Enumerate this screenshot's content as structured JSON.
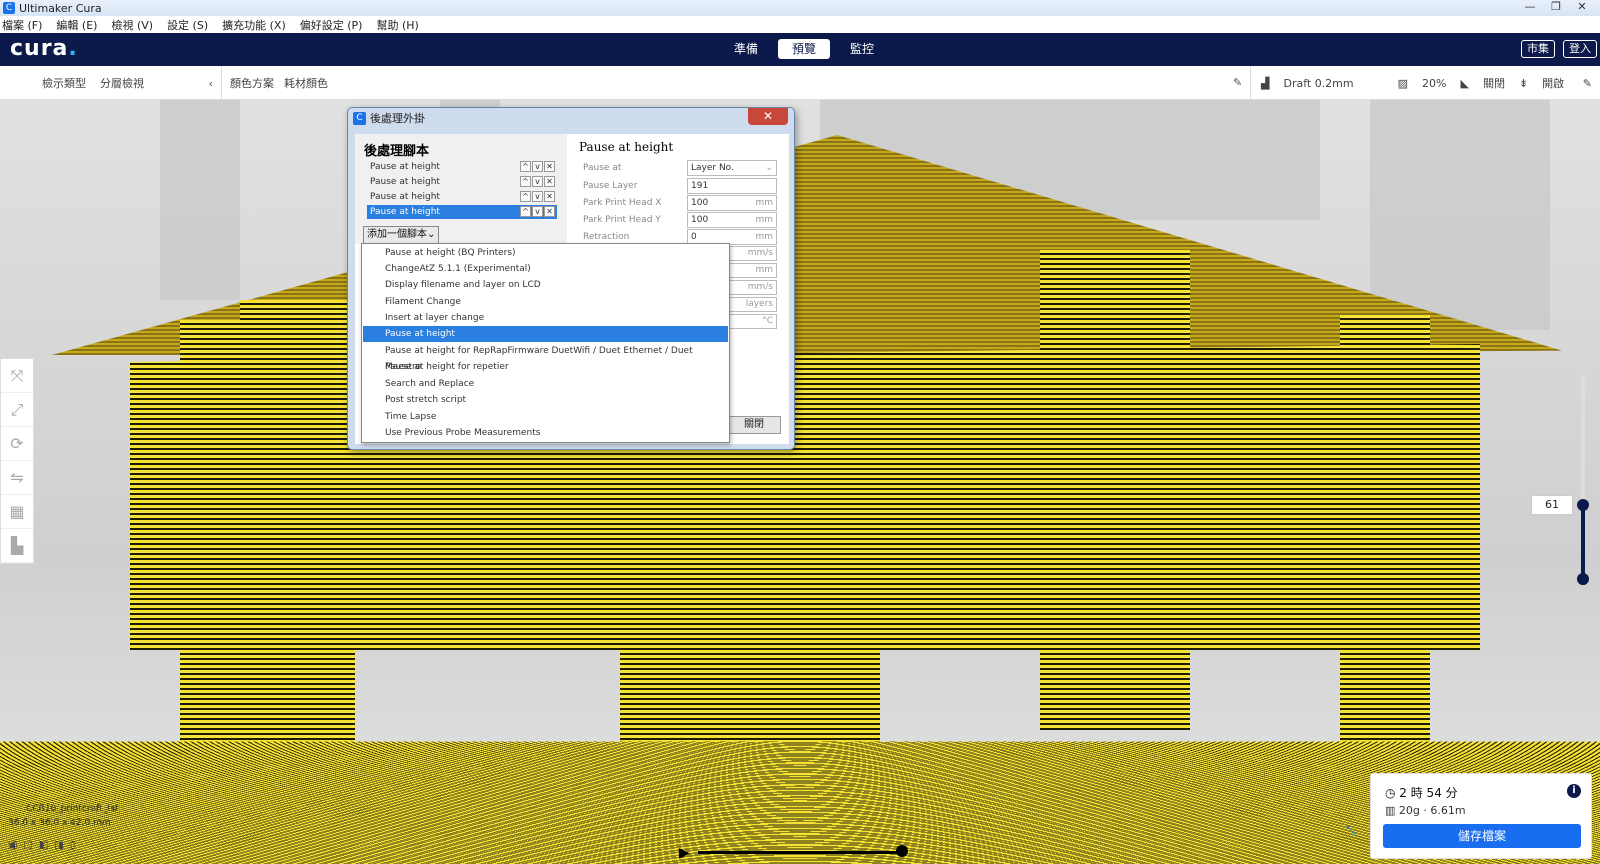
{
  "window": {
    "title": "Ultimaker Cura",
    "icon": "cura-app-icon",
    "controls": [
      "—",
      "❐",
      "✕"
    ]
  },
  "menubar": [
    "檔案 (F)",
    "編輯 (E)",
    "檢視 (V)",
    "設定 (S)",
    "擴充功能 (X)",
    "偏好設定 (P)",
    "幫助 (H)"
  ],
  "header": {
    "logo": "cura",
    "logo_dot": ".",
    "tabs": [
      {
        "label": "準備",
        "active": false
      },
      {
        "label": "預覽",
        "active": true
      },
      {
        "label": "監控",
        "active": false
      }
    ],
    "marketplace": "市集",
    "login": "登入"
  },
  "toolbar": {
    "view_type_label": "檢示類型",
    "view_type_value": "分層檢視",
    "color_scheme_label": "顏色方案",
    "color_scheme_value": "耗材顏色",
    "profile": "Draft 0.2mm",
    "infill": "20%",
    "support": "關閉",
    "adhesion": "開啟"
  },
  "layer": {
    "current": "61"
  },
  "object": {
    "filename": "CCR10_printcraft_tst",
    "dimensions": "36.0 x 36.0 x 42.0 mm"
  },
  "print_info": {
    "time": "2 時 54 分",
    "material": "20g · 6.61m",
    "save_label": "儲存檔案"
  },
  "dialog": {
    "title": "後處理外掛",
    "scripts_heading": "後處理腳本",
    "scripts": [
      {
        "label": "Pause at height",
        "selected": false
      },
      {
        "label": "Pause at height",
        "selected": false
      },
      {
        "label": "Pause at height",
        "selected": false
      },
      {
        "label": "Pause at height",
        "selected": true
      }
    ],
    "add_script": "添加一個腳本",
    "settings_heading": "Pause at height",
    "settings": [
      {
        "label": "Pause at",
        "value": "Layer No.",
        "unit": "⌄"
      },
      {
        "label": "Pause Layer",
        "value": "191",
        "unit": ""
      },
      {
        "label": "Park Print Head X",
        "value": "100",
        "unit": "mm"
      },
      {
        "label": "Park Print Head Y",
        "value": "100",
        "unit": "mm"
      },
      {
        "label": "Retraction",
        "value": "0",
        "unit": "mm"
      }
    ],
    "extra_units": [
      "mm/s",
      "mm",
      "mm/s",
      "layers",
      "°C"
    ],
    "close": "關閉",
    "dropdown_items": [
      {
        "label": "Pause at height (BQ Printers)",
        "selected": false
      },
      {
        "label": "ChangeAtZ 5.1.1 (Experimental)",
        "selected": false
      },
      {
        "label": "Display filename and layer on LCD",
        "selected": false
      },
      {
        "label": "Filament Change",
        "selected": false
      },
      {
        "label": "Insert at layer change",
        "selected": false
      },
      {
        "label": "Pause at height",
        "selected": true
      },
      {
        "label": "Pause at height for RepRapFirmware DuetWifi / Duet Ethernet / Duet Maestro",
        "selected": false
      },
      {
        "label": "Pause at height for repetier",
        "selected": false
      },
      {
        "label": "Search and Replace",
        "selected": false
      },
      {
        "label": "Post stretch script",
        "selected": false
      },
      {
        "label": "Time Lapse",
        "selected": false
      },
      {
        "label": "Use Previous Probe Measurements",
        "selected": false
      }
    ]
  },
  "colors": {
    "header_bg": "#0b1a4a",
    "accent": "#196ef0",
    "model": "#f3df2c"
  }
}
